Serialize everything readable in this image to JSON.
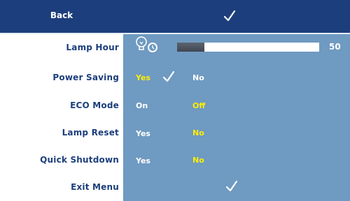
{
  "header": {
    "back_label": "Back",
    "confirm_icon": "checkmark-icon"
  },
  "rows": [
    {
      "label": "Lamp Hour"
    },
    {
      "label": "Power Saving",
      "options": [
        "Yes",
        "No"
      ],
      "selected": "Yes"
    },
    {
      "label": "ECO Mode",
      "options": [
        "On",
        "Off"
      ],
      "selected": "Off"
    },
    {
      "label": "Lamp Reset",
      "options": [
        "Yes",
        "No"
      ],
      "selected": "No"
    },
    {
      "label": "Quick Shutdown",
      "options": [
        "Yes",
        "No"
      ],
      "selected": "No"
    }
  ],
  "lamp_hour": {
    "value_text": "50",
    "level_fraction": 0.19,
    "icon": "lamp-timer-icon"
  },
  "footer": {
    "exit_label": "Exit Menu"
  },
  "colors": {
    "header_bg": "#1c3e7c",
    "panel_bg": "#6f9ac1",
    "selected_text": "#ffef00",
    "unselected_text": "#ffffff",
    "label_text": "#1c3e7c"
  }
}
